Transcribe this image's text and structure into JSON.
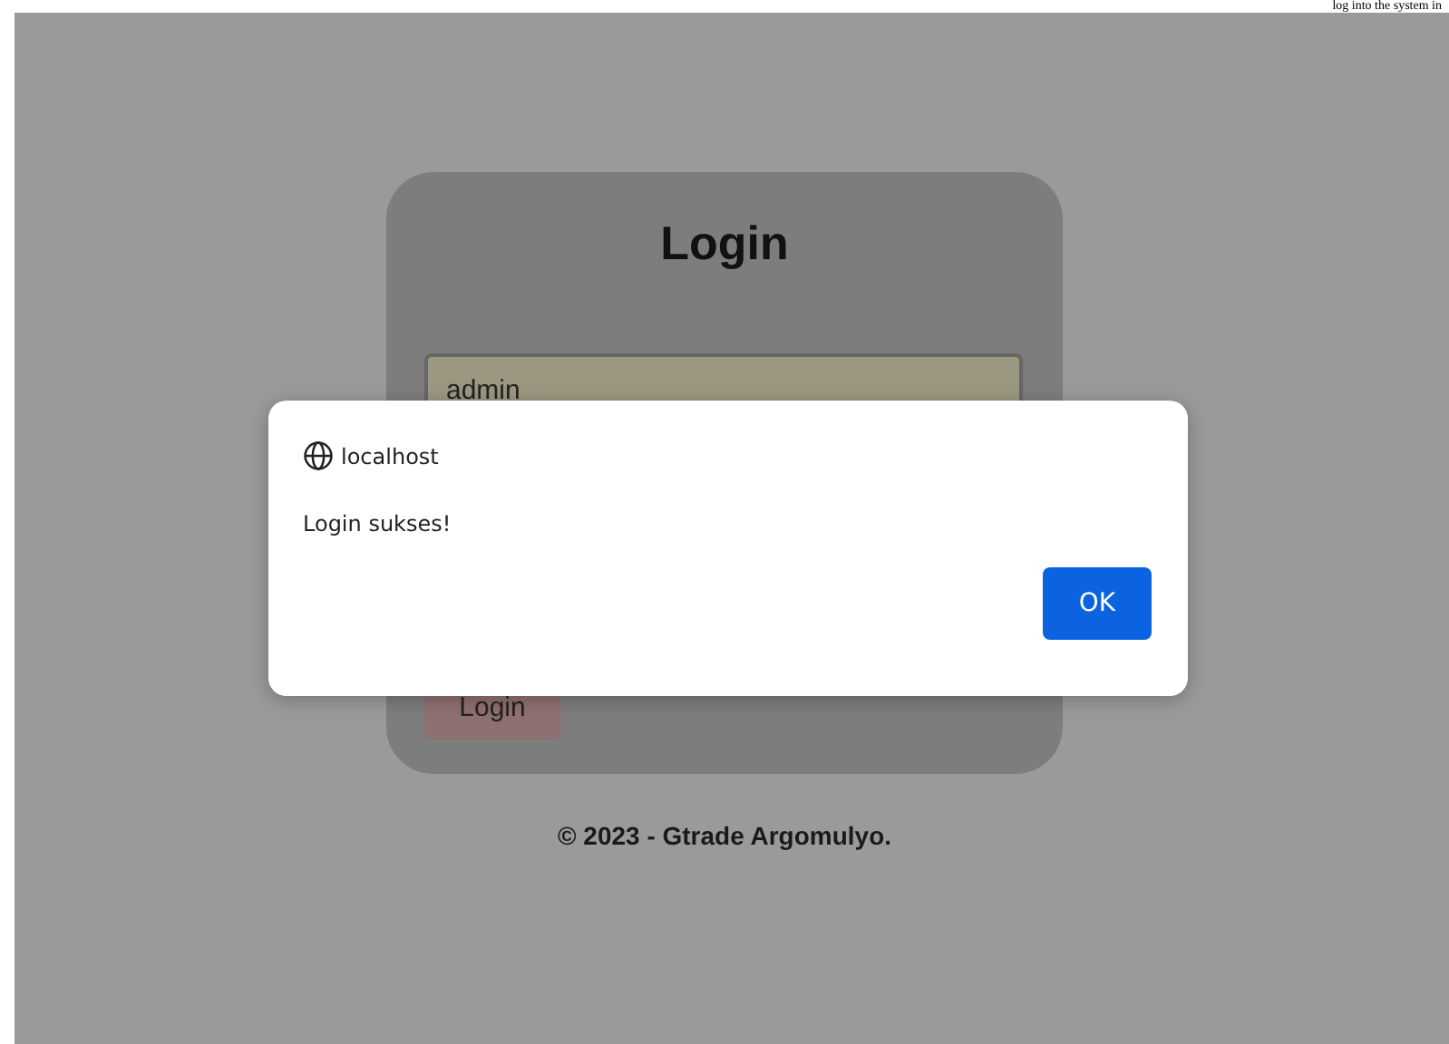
{
  "top_caption": "log into the system in",
  "login_card": {
    "title": "Login",
    "username": {
      "value": "admin"
    },
    "button": "Login"
  },
  "footer": "© 2023 - Gtrade Argomulyo.",
  "dialog": {
    "origin": "localhost",
    "message": "Login sukses!",
    "button": "OK"
  }
}
